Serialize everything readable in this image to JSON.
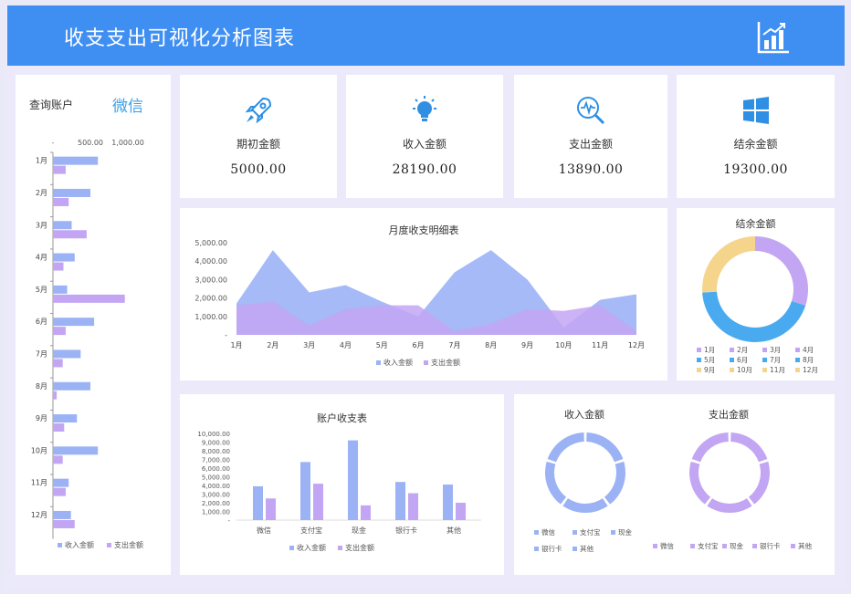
{
  "header": {
    "title": "收支支出可视化分析图表",
    "logo_icon": "bar-chart-icon"
  },
  "account": {
    "label": "查询账户",
    "value": "微信"
  },
  "kpis": [
    {
      "icon": "rocket-icon",
      "label": "期初金额",
      "value": "5000.00"
    },
    {
      "icon": "lightbulb-icon",
      "label": "收入金额",
      "value": "28190.00"
    },
    {
      "icon": "magnifier-chart-icon",
      "label": "支出金额",
      "value": "13890.00"
    },
    {
      "icon": "windows-icon",
      "label": "结余金额",
      "value": "19300.00"
    }
  ],
  "colors": {
    "income": "#9bb3f5",
    "expense": "#c3a6f3",
    "header": "#3f8ff2"
  },
  "legend": {
    "income": "收入金额",
    "expense": "支出金额"
  },
  "chart_data": [
    {
      "id": "monthly-bar",
      "type": "bar",
      "orientation": "horizontal",
      "title": "",
      "categories": [
        "1月",
        "2月",
        "3月",
        "4月",
        "5月",
        "6月",
        "7月",
        "8月",
        "9月",
        "10月",
        "11月",
        "12月"
      ],
      "x_ticks": [
        "500.00",
        "1,000.00"
      ],
      "xlim": [
        0,
        1200
      ],
      "series": [
        {
          "name": "收入金额",
          "values": [
            600,
            500,
            250,
            290,
            190,
            550,
            370,
            500,
            320,
            600,
            210,
            240
          ]
        },
        {
          "name": "支出金额",
          "values": [
            170,
            210,
            450,
            140,
            960,
            170,
            130,
            50,
            150,
            130,
            170,
            290
          ]
        }
      ],
      "legend_position": "bottom"
    },
    {
      "id": "area",
      "type": "area",
      "title": "月度收支明细表",
      "categories": [
        "1月",
        "2月",
        "3月",
        "4月",
        "5月",
        "6月",
        "7月",
        "8月",
        "9月",
        "10月",
        "11月",
        "12月"
      ],
      "y_ticks": [
        "-",
        "1,000.00",
        "2,000.00",
        "3,000.00",
        "4,000.00",
        "5,000.00"
      ],
      "ylim": [
        0,
        5000
      ],
      "series": [
        {
          "name": "收入金额",
          "values": [
            1700,
            4600,
            2300,
            2700,
            1800,
            1000,
            3400,
            4600,
            3000,
            400,
            1900,
            2200
          ]
        },
        {
          "name": "支出金额",
          "values": [
            1600,
            1800,
            500,
            1400,
            1600,
            1600,
            200,
            600,
            1400,
            1300,
            1600,
            200
          ]
        }
      ],
      "legend_position": "bottom"
    },
    {
      "id": "balance-donut",
      "type": "pie",
      "title": "结余金额",
      "labels": [
        "1月",
        "2月",
        "3月",
        "4月",
        "5月",
        "6月",
        "7月",
        "8月",
        "9月",
        "10月",
        "11月",
        "12月"
      ],
      "values": [
        0,
        0,
        0,
        30,
        0,
        0,
        0,
        44,
        0,
        0,
        0,
        26
      ],
      "colors": [
        "#c3a6f3",
        "#c3a6f3",
        "#c3a6f3",
        "#c3a6f3",
        "#4aaaf0",
        "#4aaaf0",
        "#4aaaf0",
        "#4aaaf0",
        "#f5d58c",
        "#f5d58c",
        "#f5d58c",
        "#f5d58c"
      ]
    },
    {
      "id": "account-bar",
      "type": "bar",
      "title": "账户收支表",
      "categories": [
        "微信",
        "支付宝",
        "现金",
        "银行卡",
        "其他"
      ],
      "y_ticks": [
        "-",
        "1,000.00",
        "2,000.00",
        "3,000.00",
        "4,000.00",
        "5,000.00",
        "6,000.00",
        "7,000.00",
        "8,000.00",
        "9,000.00",
        "10,000.00"
      ],
      "ylim": [
        0,
        10000
      ],
      "series": [
        {
          "name": "收入金额",
          "values": [
            3900,
            6700,
            9200,
            4400,
            4100
          ]
        },
        {
          "name": "支出金额",
          "values": [
            2500,
            4200,
            1700,
            3100,
            2000
          ]
        }
      ],
      "legend_position": "bottom"
    },
    {
      "id": "income-donut",
      "type": "pie",
      "title": "收入金额",
      "labels": [
        "微信",
        "支付宝",
        "现金",
        "银行卡",
        "其他"
      ],
      "values": [
        20,
        20,
        20,
        20,
        20
      ],
      "colors": [
        "#9bb3f5",
        "#9bb3f5",
        "#9bb3f5",
        "#9bb3f5",
        "#9bb3f5"
      ]
    },
    {
      "id": "expense-donut",
      "type": "pie",
      "title": "支出金额",
      "labels": [
        "微信",
        "支付宝",
        "现金",
        "银行卡",
        "其他"
      ],
      "values": [
        20,
        20,
        20,
        20,
        20
      ],
      "colors": [
        "#c3a6f3",
        "#c3a6f3",
        "#c3a6f3",
        "#c3a6f3",
        "#c3a6f3"
      ]
    }
  ]
}
